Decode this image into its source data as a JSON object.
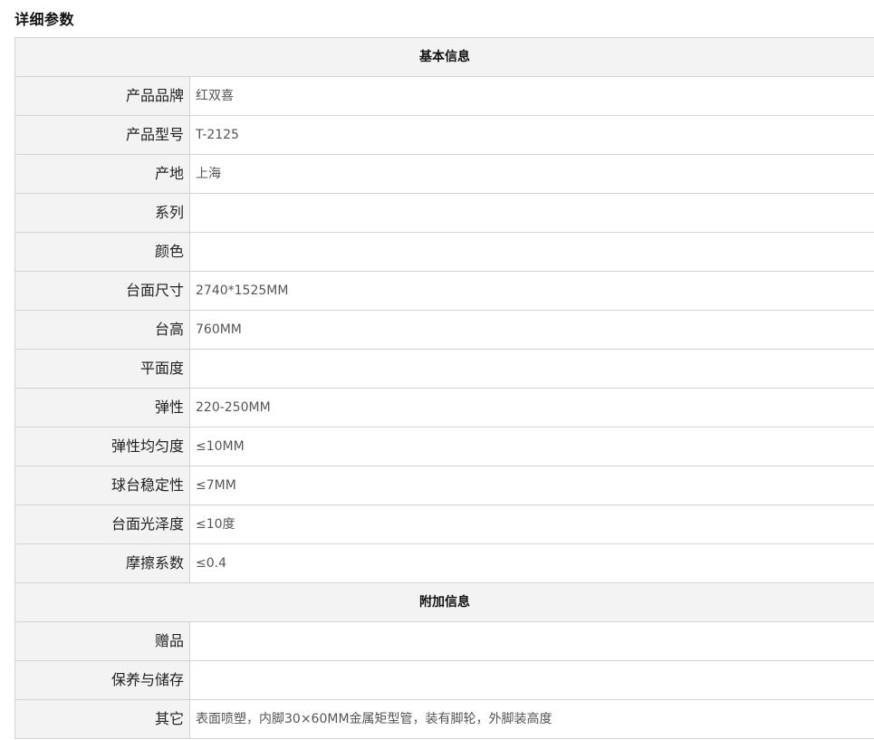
{
  "page_title": "详细参数",
  "sections": [
    {
      "title": "基本信息",
      "rows": [
        {
          "label": "产品品牌",
          "value": "红双喜"
        },
        {
          "label": "产品型号",
          "value": "T-2125"
        },
        {
          "label": "产地",
          "value": "上海"
        },
        {
          "label": "系列",
          "value": ""
        },
        {
          "label": "颜色",
          "value": ""
        },
        {
          "label": "台面尺寸",
          "value": "2740*1525MM"
        },
        {
          "label": "台高",
          "value": "760MM"
        },
        {
          "label": "平面度",
          "value": ""
        },
        {
          "label": "弹性",
          "value": "220-250MM"
        },
        {
          "label": "弹性均匀度",
          "value": "≤10MM"
        },
        {
          "label": "球台稳定性",
          "value": "≤7MM"
        },
        {
          "label": "台面光泽度",
          "value": "≤10度"
        },
        {
          "label": "摩擦系数",
          "value": "≤0.4"
        }
      ]
    },
    {
      "title": "附加信息",
      "rows": [
        {
          "label": "赠品",
          "value": ""
        },
        {
          "label": "保养与储存",
          "value": ""
        },
        {
          "label": "其它",
          "value": "表面喷塑，内脚30×60MM金属矩型管，装有脚轮，外脚装高度"
        }
      ]
    }
  ]
}
